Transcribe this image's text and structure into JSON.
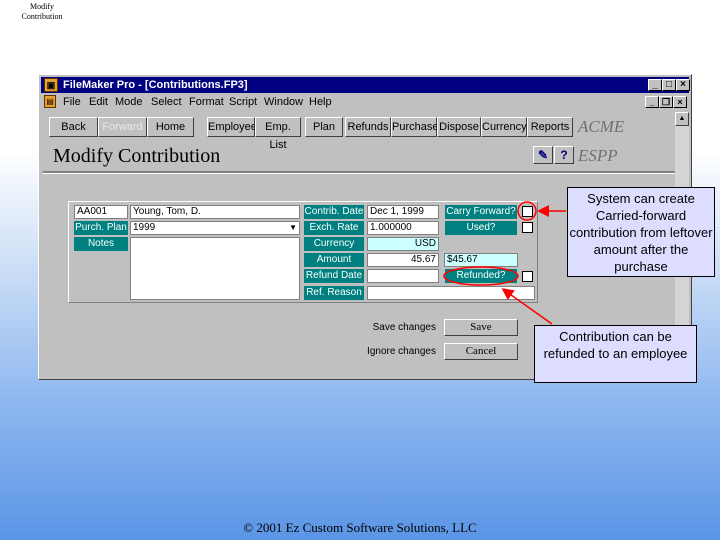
{
  "slide": {
    "label": "Modify Contribution",
    "footer": "© 2001 Ez Custom Software Solutions, LLC"
  },
  "window": {
    "title": "FileMaker Pro - [Contributions.FP3]",
    "menu": [
      "File",
      "Edit",
      "Mode",
      "Select",
      "Format",
      "Script",
      "Window",
      "Help"
    ]
  },
  "toolbar": {
    "buttons": [
      "Back",
      "Forward",
      "Home",
      "Employee",
      "Emp. List",
      "Plan",
      "Refunds",
      "Purchase",
      "Dispose",
      "Currency",
      "Reports"
    ],
    "brand": "ACME",
    "subbrand": "ESPP"
  },
  "page": {
    "title": "Modify Contribution"
  },
  "form": {
    "employee_id": "AA001",
    "employee_name": "Young, Tom, D.",
    "purch_plan_label": "Purch. Plan",
    "purch_plan_value": "1999",
    "notes_label": "Notes",
    "contrib_date_label": "Contrib. Date",
    "contrib_date": "Dec 1, 1999",
    "exch_rate_label": "Exch. Rate",
    "exch_rate": "1.000000",
    "currency_label": "Currency",
    "currency": "USD",
    "amount_label": "Amount",
    "amount": "45.67",
    "amount_converted": "$45.67",
    "refund_date_label": "Refund Date",
    "refund_date": "",
    "ref_reason_label": "Ref. Reason",
    "ref_reason": "",
    "carry_forward_label": "Carry Forward?",
    "used_label": "Used?",
    "refunded_label": "Refunded?"
  },
  "actions": {
    "save_label": "Save changes",
    "save_button": "Save",
    "ignore_label": "Ignore changes",
    "cancel_button": "Cancel"
  },
  "callouts": {
    "carry_forward": "System can create Carried-forward contribution from leftover amount after the purchase",
    "refund": "Contribution can be refunded to an employee"
  },
  "colors": {
    "title_bar": "#000080",
    "label_bg": "#008080",
    "callout_bg": "#ddddff",
    "highlight": "#ff0000"
  }
}
